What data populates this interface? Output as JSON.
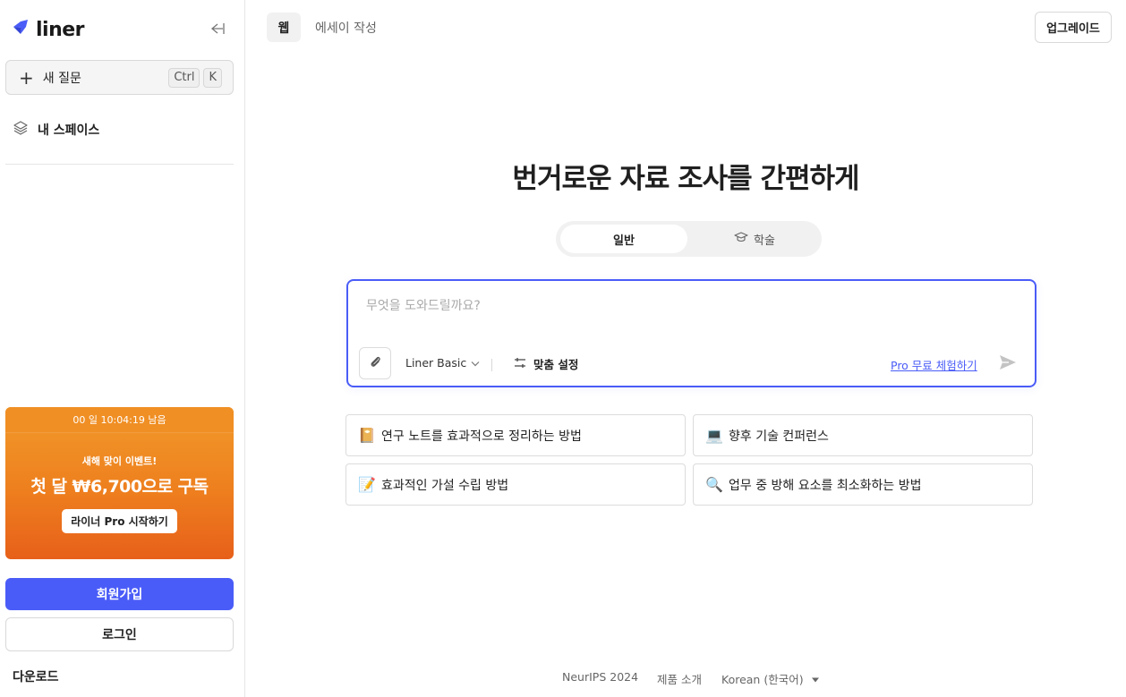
{
  "sidebar": {
    "logo_text": "liner",
    "new_question": {
      "label": "새 질문",
      "shortcut": [
        "Ctrl",
        "K"
      ]
    },
    "my_space": "내 스페이스",
    "promo": {
      "countdown": "00 일 10:04:19 남음",
      "subtitle": "새해 맞이 이벤트!",
      "headline": "첫 달 ₩6,700으로 구독",
      "button": "라이너 Pro 시작하기"
    },
    "signup": "회원가입",
    "login": "로그인",
    "download": "다운로드"
  },
  "header": {
    "tabs": [
      {
        "label": "웹",
        "active": true
      },
      {
        "label": "에세이 작성",
        "active": false
      }
    ],
    "upgrade": "업그레이드"
  },
  "main": {
    "headline": "번거로운 자료 조사를 간편하게",
    "modes": [
      {
        "label": "일반",
        "active": true
      },
      {
        "label": "학술",
        "active": false,
        "icon": "graduation-cap-icon"
      }
    ],
    "search": {
      "placeholder": "무엇을 도와드릴까요?",
      "value": "",
      "model": "Liner Basic",
      "custom_settings": "맞춤 설정",
      "pro_trial": "Pro 무료 체험하기"
    },
    "suggestions": [
      {
        "emoji": "📔",
        "text": "연구 노트를 효과적으로 정리하는 방법"
      },
      {
        "emoji": "💻",
        "text": "향후 기술 컨퍼런스"
      },
      {
        "emoji": "📝",
        "text": "효과적인 가설 수립 방법"
      },
      {
        "emoji": "🔍",
        "text": "업무 중 방해 요소를 최소화하는 방법"
      }
    ]
  },
  "footer": {
    "neurips": "NeurIPS 2024",
    "product": "제품 소개",
    "language": "Korean (한국어)"
  },
  "colors": {
    "accent": "#4a5cf7",
    "promo": "#ee7f1e"
  }
}
